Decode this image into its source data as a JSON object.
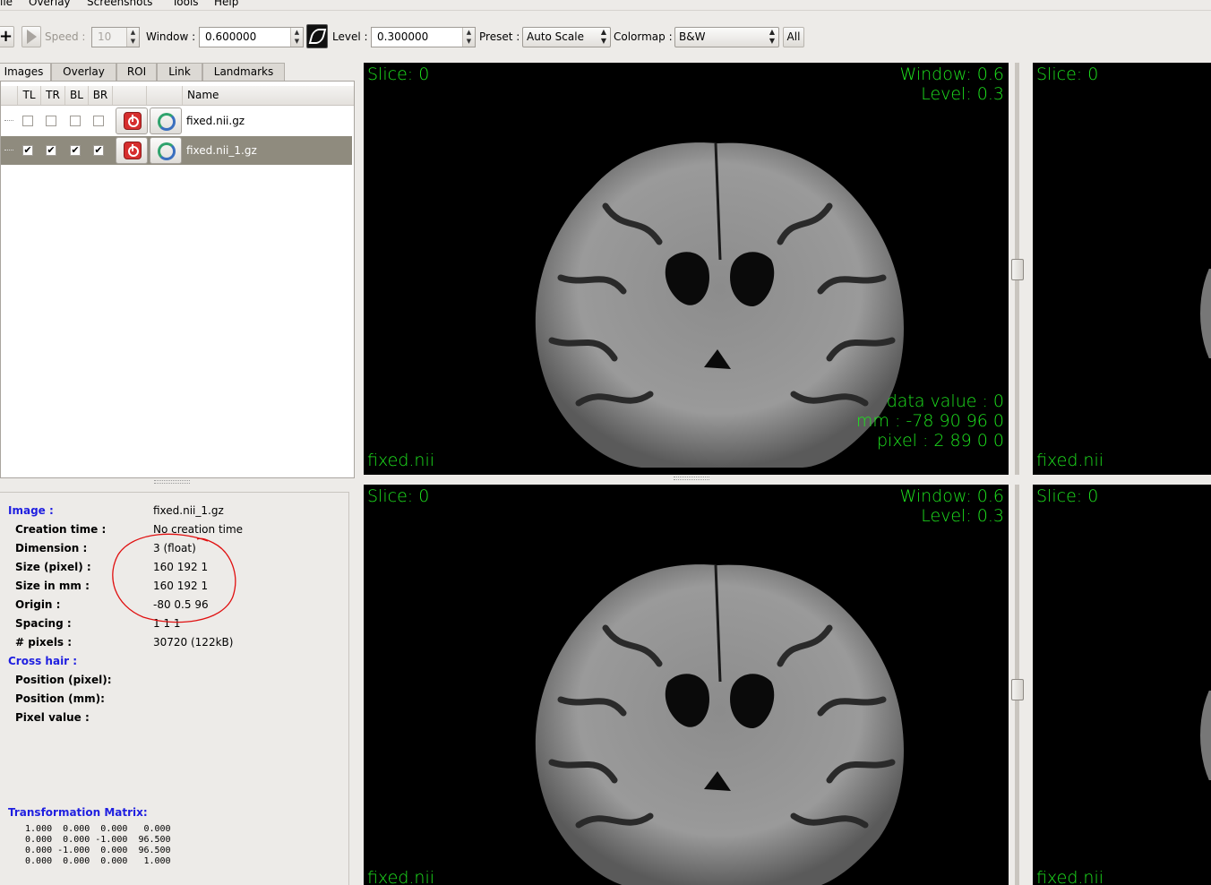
{
  "menu": [
    "ile",
    "Overlay",
    "Screenshots",
    "Tools",
    "Help"
  ],
  "toolbar": {
    "speed_label": "Speed :",
    "speed_value": "10",
    "window_label": "Window :",
    "window_value": "0.600000",
    "level_label": "Level :",
    "level_value": "0.300000",
    "preset_label": "Preset :",
    "preset_value": "Auto Scale",
    "colormap_label": "Colormap :",
    "colormap_value": "B&W",
    "all_label": "All"
  },
  "tabs": [
    "Images",
    "Overlay",
    "ROI",
    "Link",
    "Landmarks"
  ],
  "list": {
    "columns": [
      "TL",
      "TR",
      "BL",
      "BR",
      "",
      "",
      "Name"
    ],
    "rows": [
      {
        "name": "fixed.nii.gz",
        "checked": [
          false,
          false,
          false,
          false
        ],
        "selected": false
      },
      {
        "name": "fixed.nii_1.gz",
        "checked": [
          true,
          true,
          true,
          true
        ],
        "selected": true
      }
    ]
  },
  "info": {
    "image_label": "Image :",
    "image_value": "fixed.nii_1.gz",
    "fields": [
      {
        "key": "Creation time :",
        "value": "No creation time"
      },
      {
        "key": "Dimension :",
        "value": "3 (float)"
      },
      {
        "key": "Size (pixel) :",
        "value": "160 192 1"
      },
      {
        "key": "Size in mm :",
        "value": "160 192 1"
      },
      {
        "key": "Origin :",
        "value": "-80 0.5 96"
      },
      {
        "key": "Spacing :",
        "value": "1 1 1"
      },
      {
        "key": "# pixels :",
        "value": "30720 (122kB)"
      }
    ],
    "crosshair_label": "Cross hair :",
    "crosshair_fields": [
      "Position (pixel):",
      "Position (mm):",
      "Pixel value :"
    ],
    "transform_label": "Transformation Matrix:",
    "matrix": " 1.000  0.000  0.000   0.000\n 0.000  0.000 -1.000  96.500\n 0.000 -1.000  0.000  96.500\n 0.000  0.000  0.000   1.000"
  },
  "views": {
    "tl": {
      "slice": "Slice: 0",
      "window": "Window: 0.6",
      "level": "Level: 0.3",
      "data_value": "data value : 0",
      "mm": "mm : -78 90 96 0",
      "pixel": "pixel : 2 89 0 0",
      "name": "fixed.nii"
    },
    "tr": {
      "slice": "Slice: 0",
      "name": "fixed.nii"
    },
    "bl": {
      "slice": "Slice: 0",
      "window": "Window: 0.6",
      "level": "Level: 0.3",
      "name": "fixed.nii"
    },
    "br": {
      "slice": "Slice: 0",
      "name": "fixed.nii"
    }
  },
  "colors": {
    "overlay_text": "#1ee51e",
    "info_heading": "#1f1fe0",
    "selected_row": "#8f8b7e",
    "annotation_circle": "#e01010"
  }
}
